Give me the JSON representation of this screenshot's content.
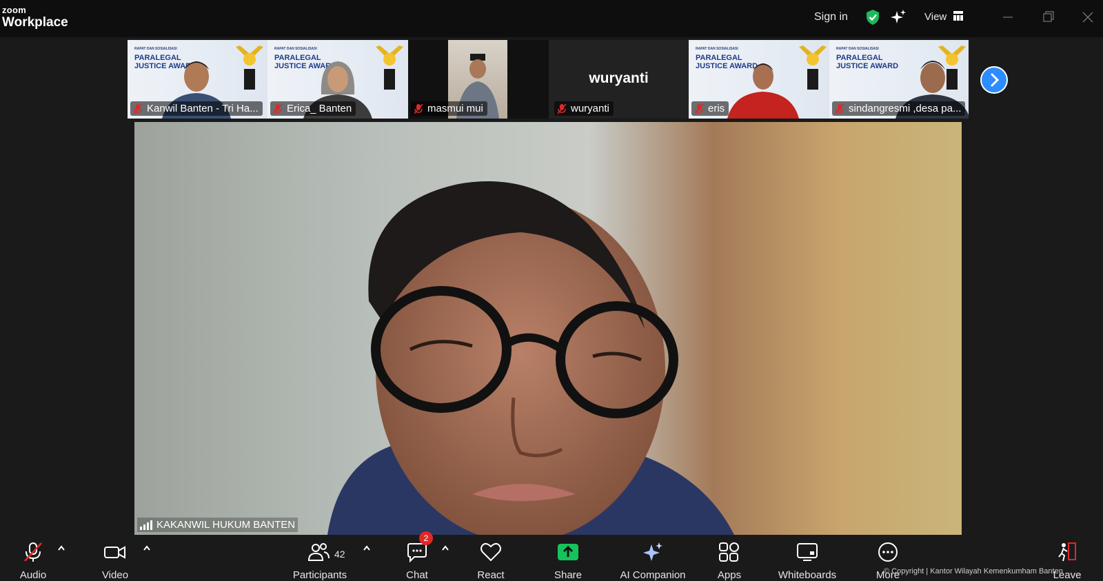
{
  "app": {
    "logo_top": "zoom",
    "logo_bottom": "Workplace"
  },
  "titlebar": {
    "sign_in": "Sign in",
    "view": "View"
  },
  "award": {
    "line1": "PARALEGAL",
    "line2": "JUSTICE AWARD",
    "subtitle": "RAPAT DAN SOSIALISASI"
  },
  "participants_strip": [
    {
      "name": "Kanwil Banten - Tri Ha...",
      "muted": true,
      "video": true
    },
    {
      "name": "Erica_ Banten",
      "muted": true,
      "video": true
    },
    {
      "name": "masmui mui",
      "muted": true,
      "video": true
    },
    {
      "name": "wuryanti",
      "muted": true,
      "video": false,
      "display_name": "wuryanti"
    },
    {
      "name": "eris",
      "muted": true,
      "video": true
    },
    {
      "name": "sindangresmi ,desa pa...",
      "muted": true,
      "video": true
    }
  ],
  "active_speaker": {
    "label": "KAKANWIL HUKUM BANTEN"
  },
  "toolbar": {
    "audio": "Audio",
    "video": "Video",
    "participants": "Participants",
    "participants_count": "42",
    "chat": "Chat",
    "chat_badge": "2",
    "react": "React",
    "share": "Share",
    "ai_companion": "AI Companion",
    "apps": "Apps",
    "whiteboards": "Whiteboards",
    "more": "More",
    "leave": "Leave"
  },
  "copyright": "© Copyright | Kantor Wilayah Kemenkumham Banten",
  "colors": {
    "accent_blue": "#2d8cff",
    "share_green": "#16c35a",
    "mute_red": "#e02828",
    "shield_green": "#1fb95a",
    "leave_red": "#e02828"
  }
}
